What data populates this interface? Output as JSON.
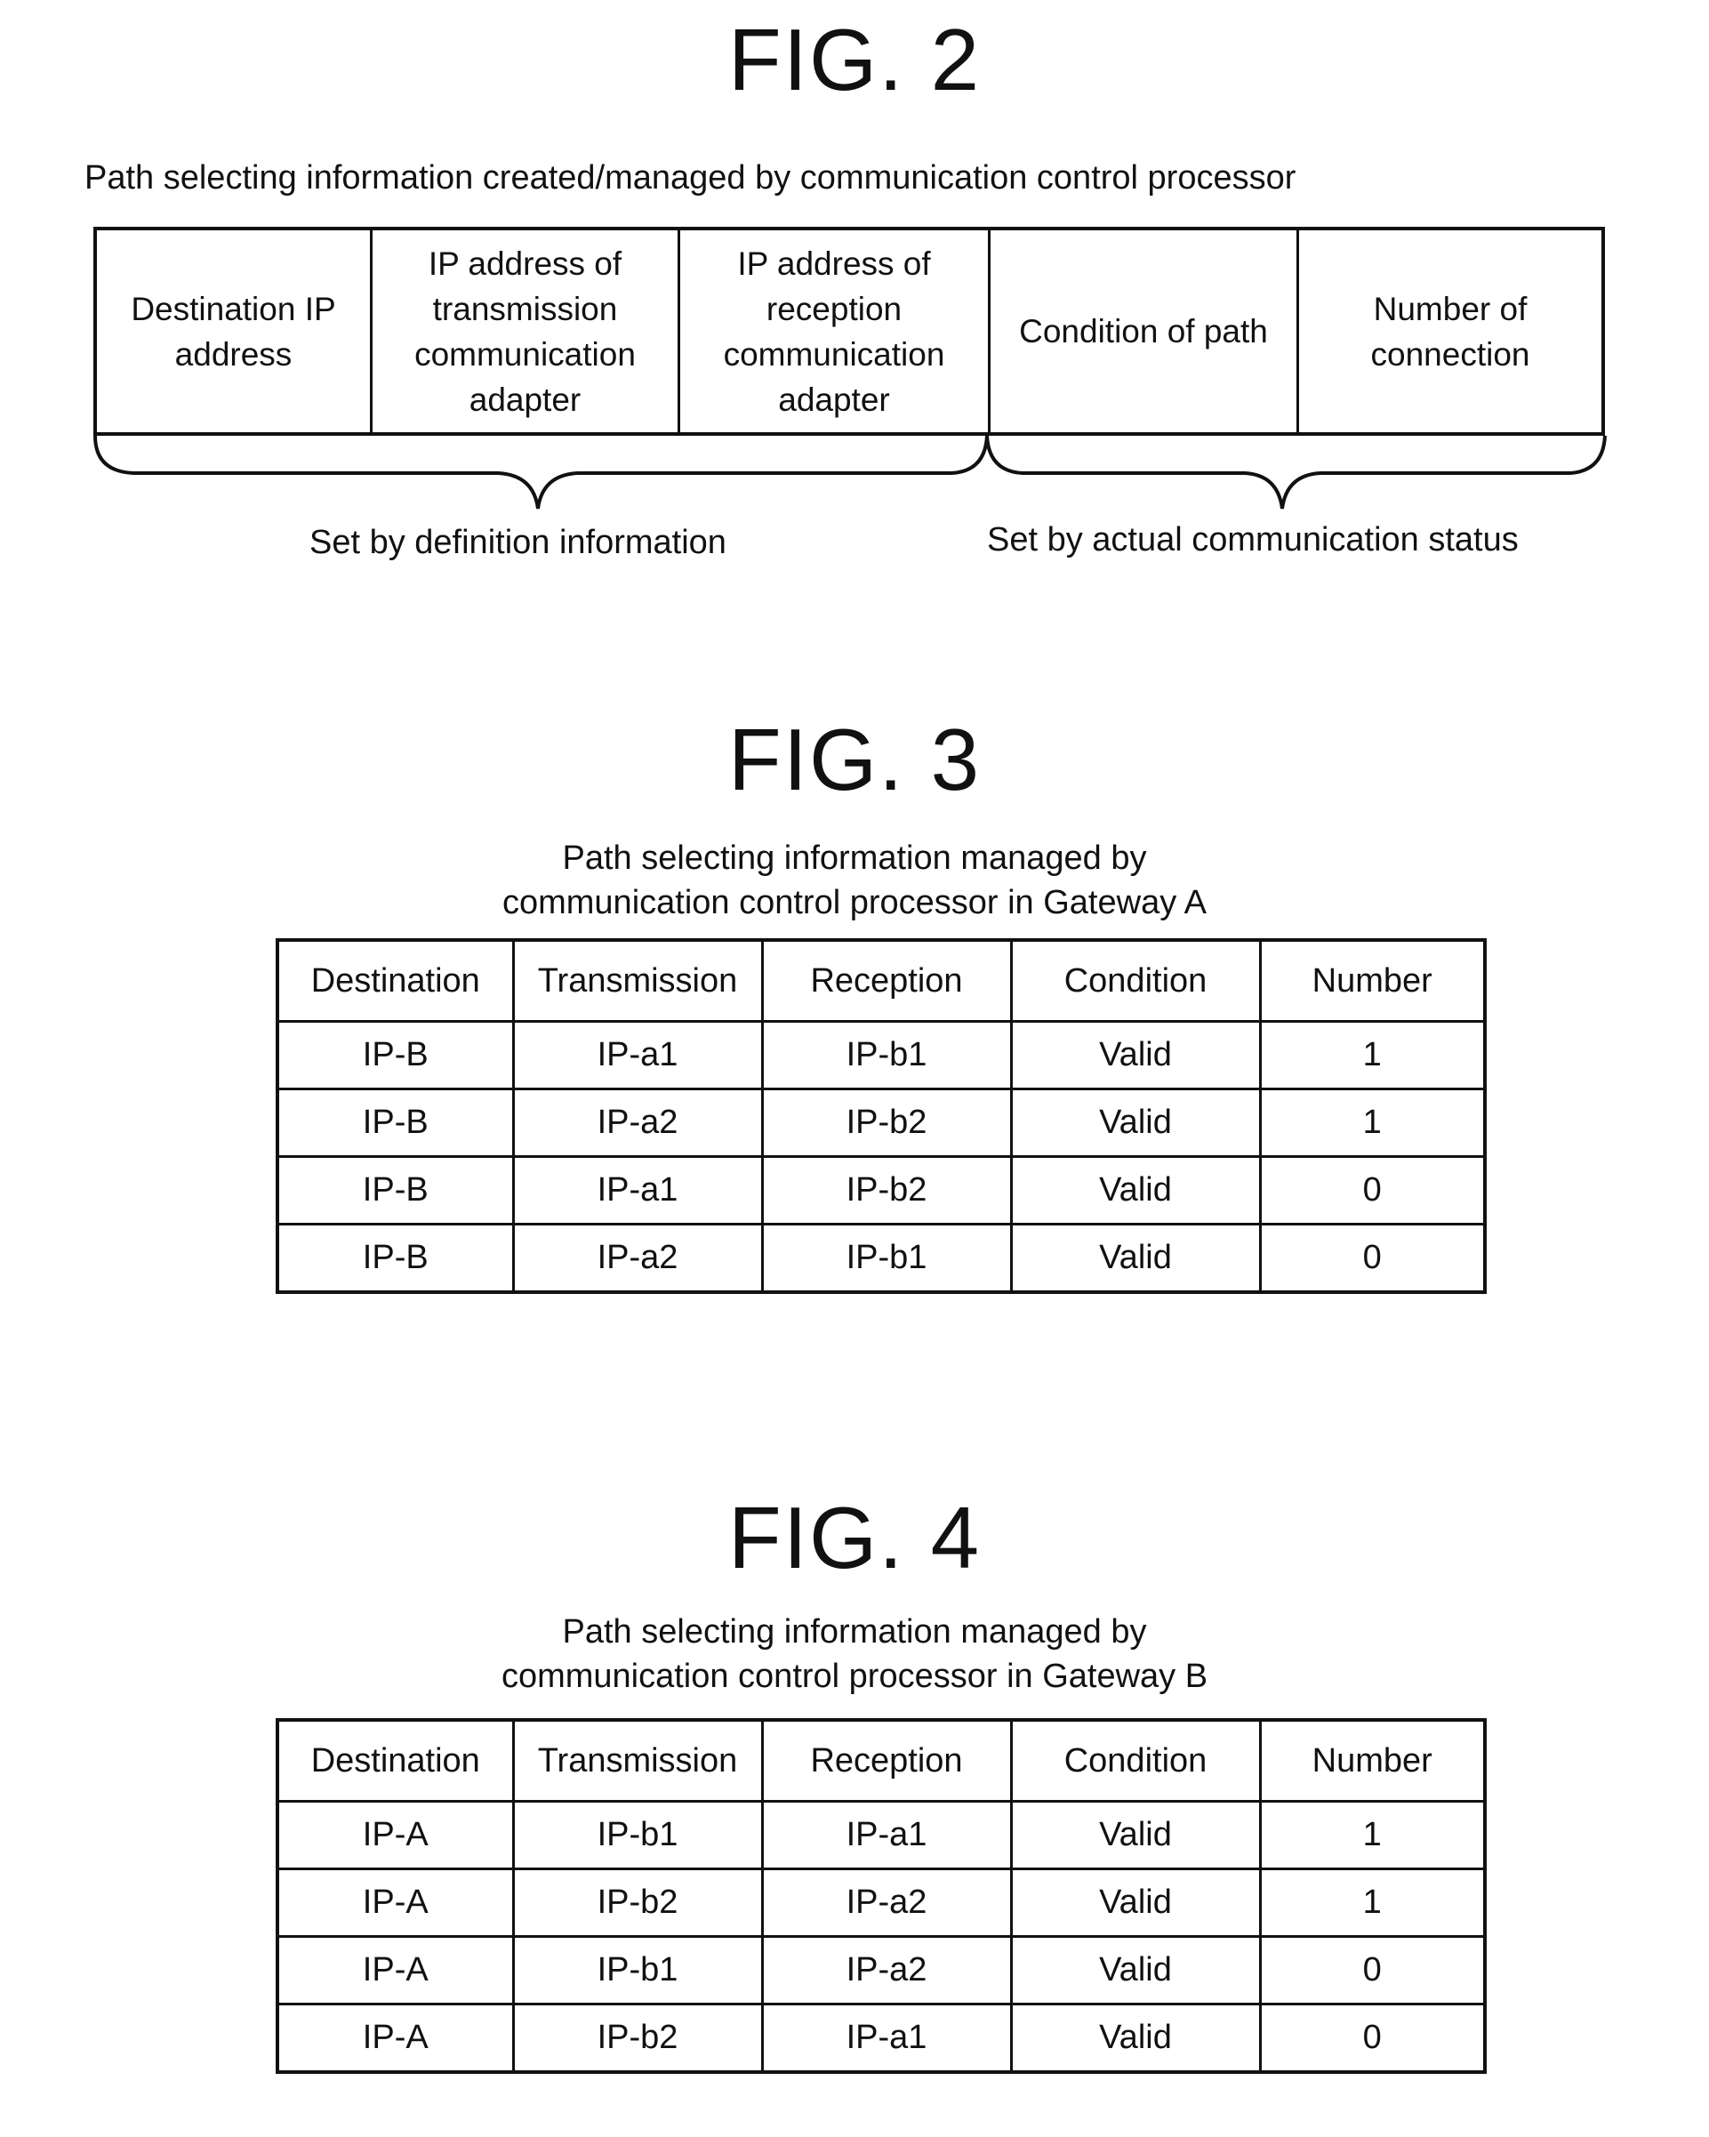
{
  "fig2": {
    "title": "FIG. 2",
    "caption": "Path selecting information created/managed by communication control processor",
    "fields": [
      "Destination IP address",
      "IP address of transmission communication adapter",
      "IP address of reception communication adapter",
      "Condition of path",
      "Number of connection"
    ],
    "groups": [
      {
        "label": "Set by definition information",
        "covers": [
          "Destination IP address",
          "IP address of transmission communication adapter",
          "IP address of reception communication adapter"
        ]
      },
      {
        "label": "Set by actual communication status",
        "covers": [
          "Condition of path",
          "Number of connection"
        ]
      }
    ]
  },
  "fig3": {
    "title": "FIG. 3",
    "caption_line1": "Path selecting information managed by",
    "caption_line2": "communication control processor in Gateway A",
    "headers": [
      "Destination",
      "Transmission",
      "Reception",
      "Condition",
      "Number"
    ],
    "rows": [
      [
        "IP-B",
        "IP-a1",
        "IP-b1",
        "Valid",
        "1"
      ],
      [
        "IP-B",
        "IP-a2",
        "IP-b2",
        "Valid",
        "1"
      ],
      [
        "IP-B",
        "IP-a1",
        "IP-b2",
        "Valid",
        "0"
      ],
      [
        "IP-B",
        "IP-a2",
        "IP-b1",
        "Valid",
        "0"
      ]
    ]
  },
  "fig4": {
    "title": "FIG. 4",
    "caption_line1": "Path selecting information managed by",
    "caption_line2": "communication control processor in Gateway B",
    "headers": [
      "Destination",
      "Transmission",
      "Reception",
      "Condition",
      "Number"
    ],
    "rows": [
      [
        "IP-A",
        "IP-b1",
        "IP-a1",
        "Valid",
        "1"
      ],
      [
        "IP-A",
        "IP-b2",
        "IP-a2",
        "Valid",
        "1"
      ],
      [
        "IP-A",
        "IP-b1",
        "IP-a2",
        "Valid",
        "0"
      ],
      [
        "IP-A",
        "IP-b2",
        "IP-a1",
        "Valid",
        "0"
      ]
    ]
  }
}
